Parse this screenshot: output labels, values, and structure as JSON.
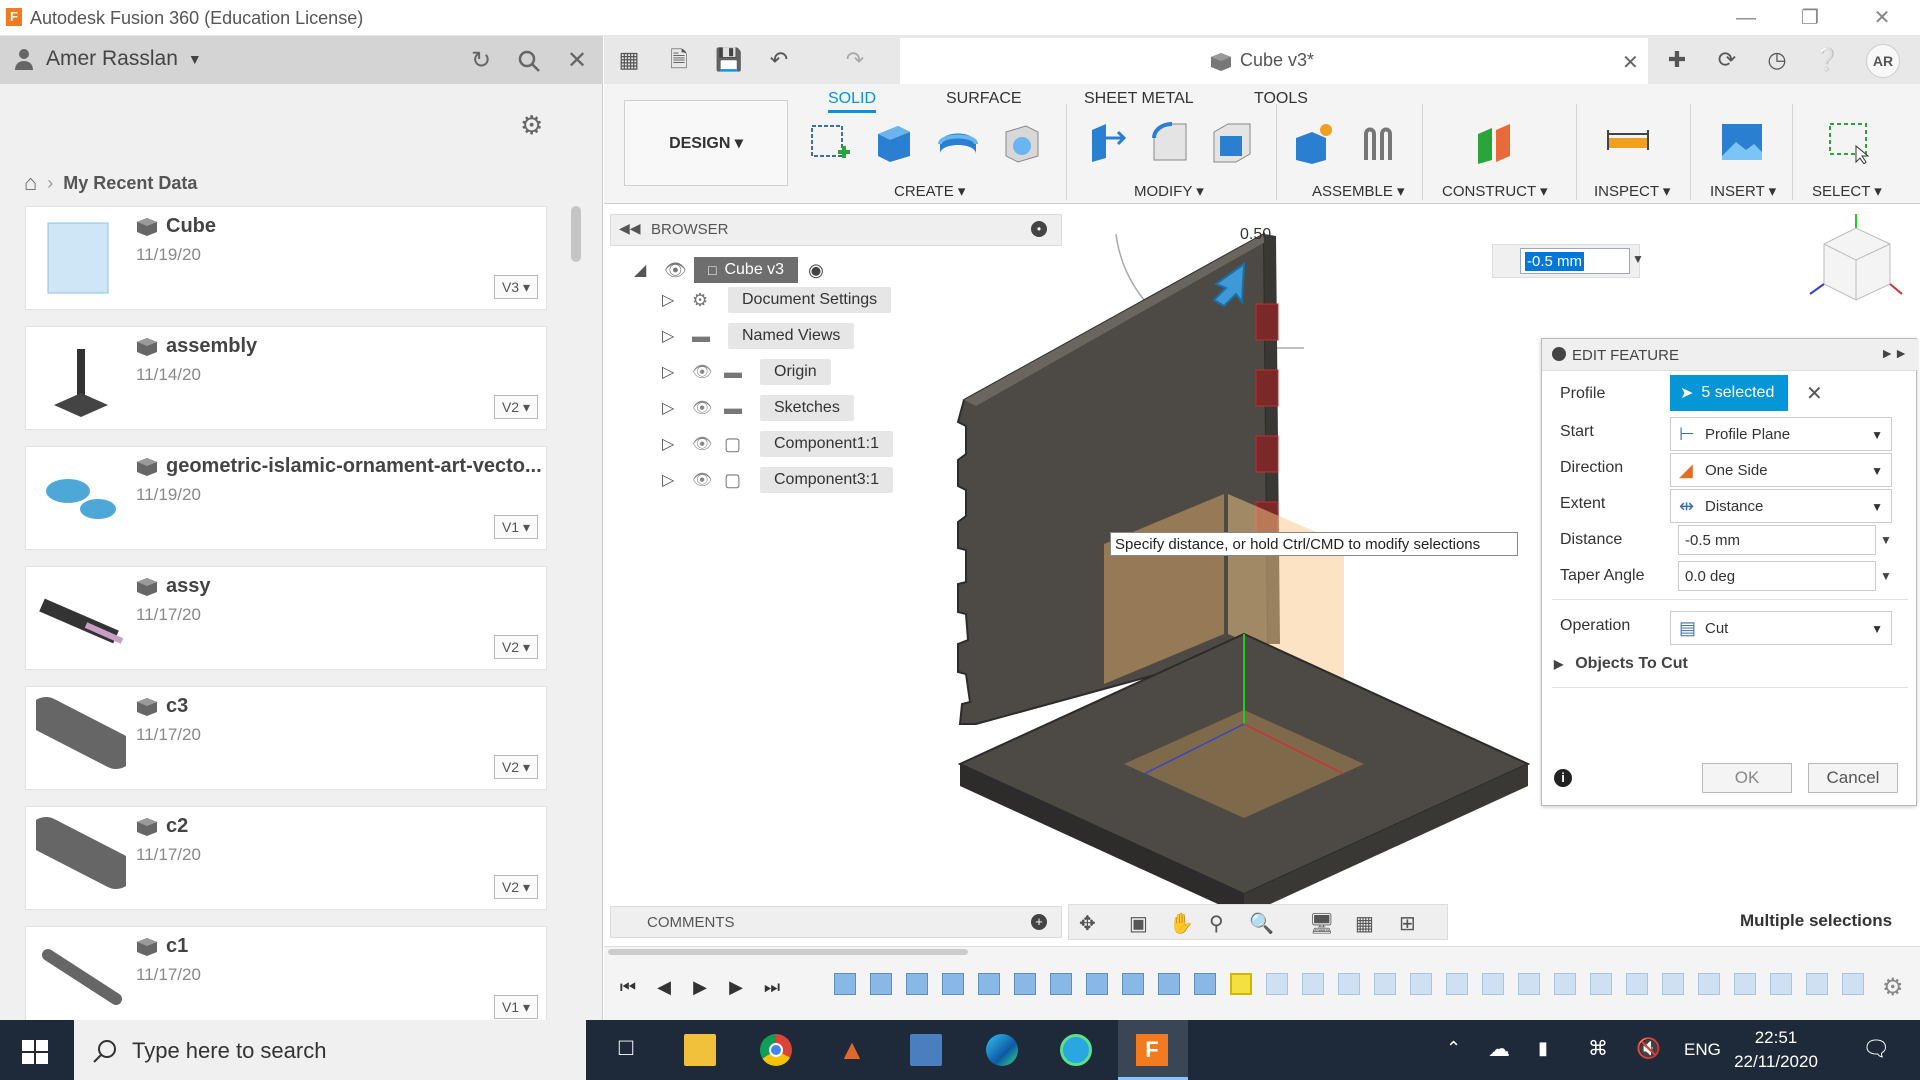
{
  "window": {
    "title": "Autodesk Fusion 360 (Education License)"
  },
  "left_panel": {
    "user": "Amer Rasslan",
    "breadcrumb": "My Recent Data",
    "files": [
      {
        "name": "Cube",
        "date": "11/19/20",
        "version": "V3"
      },
      {
        "name": "assembly",
        "date": "11/14/20",
        "version": "V2"
      },
      {
        "name": "geometric-islamic-ornament-art-vecto...",
        "date": "11/19/20",
        "version": "V1"
      },
      {
        "name": "assy",
        "date": "11/17/20",
        "version": "V2"
      },
      {
        "name": "c3",
        "date": "11/17/20",
        "version": "V2"
      },
      {
        "name": "c2",
        "date": "11/17/20",
        "version": "V2"
      },
      {
        "name": "c1",
        "date": "11/17/20",
        "version": "V1"
      }
    ]
  },
  "doc_tab": {
    "title": "Cube v3*"
  },
  "avatar": "AR",
  "ribbon": {
    "design": "DESIGN",
    "tabs": [
      "SOLID",
      "SURFACE",
      "SHEET METAL",
      "TOOLS"
    ],
    "groups": [
      "CREATE",
      "MODIFY",
      "ASSEMBLE",
      "CONSTRUCT",
      "INSPECT",
      "INSERT",
      "SELECT"
    ]
  },
  "browser": {
    "title": "BROWSER",
    "root": "Cube v3",
    "items": [
      "Document Settings",
      "Named Views",
      "Origin",
      "Sketches",
      "Component1:1",
      "Component3:1"
    ]
  },
  "comments": "COMMENTS",
  "viewport": {
    "distance_input": "-0.5 mm",
    "dim_label": "0.50",
    "tooltip": "Specify distance, or hold Ctrl/CMD to modify selections",
    "status": "Multiple selections"
  },
  "edit_feature": {
    "title": "EDIT FEATURE",
    "profile_label": "Profile",
    "profile_value": "5 selected",
    "start_label": "Start",
    "start_value": "Profile Plane",
    "direction_label": "Direction",
    "direction_value": "One Side",
    "extent_label": "Extent",
    "extent_value": "Distance",
    "distance_label": "Distance",
    "distance_value": "-0.5 mm",
    "taper_label": "Taper Angle",
    "taper_value": "0.0 deg",
    "operation_label": "Operation",
    "operation_value": "Cut",
    "objects_to_cut": "Objects To Cut",
    "ok": "OK",
    "cancel": "Cancel"
  },
  "taskbar": {
    "search_placeholder": "Type here to search",
    "lang": "ENG",
    "time": "22:51",
    "date": "22/11/2020"
  }
}
